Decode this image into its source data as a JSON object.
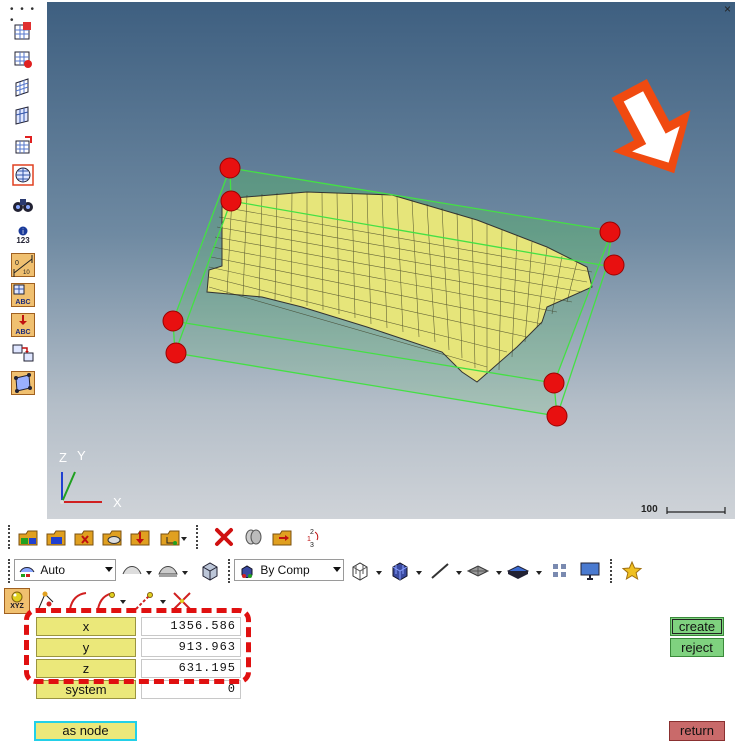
{
  "viewport": {
    "axis_z": "Z",
    "axis_y": "Y",
    "axis_x": "X",
    "scale_label": "100",
    "close_glyph": "×"
  },
  "left_toolbar": {
    "icons": [
      "grid-snap-icon",
      "pick-mesh-icon",
      "mesh-plane-icon",
      "mesh-select-icon",
      "mesh-edit-icon",
      "globe-mesh-icon",
      "binoculars-icon",
      "numbering-icon",
      "measure-icon",
      "label-abc-icon",
      "label-abc-down-icon",
      "flip-icon",
      "frame-icon"
    ],
    "numbering_text": "123",
    "abc_text": "ABC"
  },
  "toolbar_row2": {
    "auto_label": "Auto",
    "bycomp_label": "By Comp"
  },
  "toolbar_row3": {
    "xyz_badge": "XYZ"
  },
  "form": {
    "x_label": "x",
    "x_value": "1356.586",
    "y_label": "y",
    "y_value": "913.963",
    "z_label": "z",
    "z_value": "631.195",
    "system_label": "system",
    "system_value": "0",
    "as_node_label": "as node",
    "create_label": "create",
    "reject_label": "reject",
    "return_label": "return"
  },
  "colors": {
    "mesh_fill": "#e6e57a",
    "bbox_line": "#44e044",
    "node_red": "#e81010",
    "arrow_orange": "#f04a10",
    "field_yellow": "#ebe87a",
    "button_green": "#7fd27f",
    "button_red": "#c96a6a"
  }
}
